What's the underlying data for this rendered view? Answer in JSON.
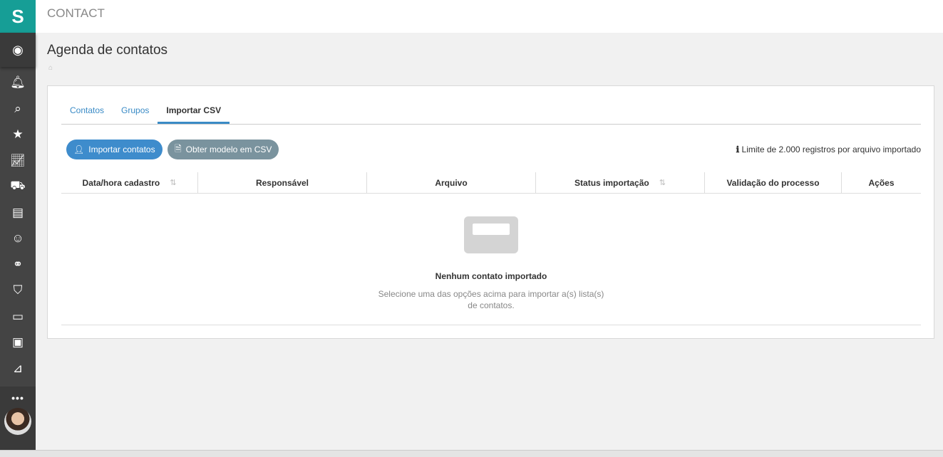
{
  "header": {
    "app": "CONTACT",
    "title": "Agenda de contatos"
  },
  "tabs": [
    {
      "label": "Contatos"
    },
    {
      "label": "Grupos"
    },
    {
      "label": "Importar CSV"
    }
  ],
  "buttons": {
    "import": "Importar contatos",
    "template": "Obter modelo em CSV"
  },
  "limit_info": "Limite de 2.000 registros por arquivo importado",
  "table": {
    "columns": [
      "Data/hora cadastro",
      "Responsável",
      "Arquivo",
      "Status importação",
      "Validação do processo",
      "Ações"
    ]
  },
  "empty": {
    "title": "Nenhum contato importado",
    "message": "Selecione uma das opções acima para importar a(s) lista(s) de contatos."
  },
  "sidebar": {
    "more": "•••"
  },
  "colors": {
    "brand": "#169e96",
    "primary": "#3e8ccc",
    "secondary": "#7a939e"
  }
}
